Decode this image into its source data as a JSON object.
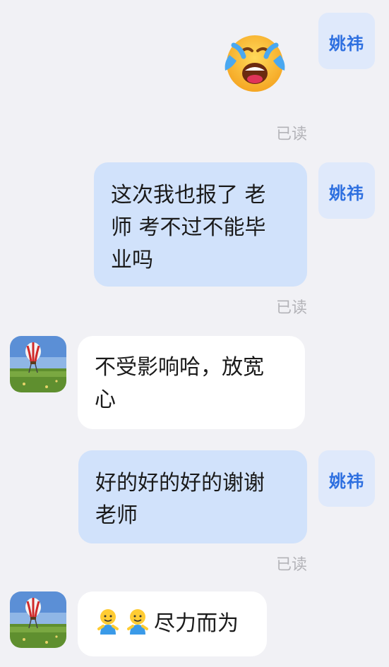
{
  "messages": [
    {
      "type": "outgoing-sticker",
      "sender": "姚祎",
      "sticker": "loudly-crying-face-icon",
      "status": "已读"
    },
    {
      "type": "outgoing-text",
      "sender": "姚祎",
      "lines": [
        "这次我也报了 老",
        "师 考不过不能毕",
        "业吗"
      ],
      "status": "已读"
    },
    {
      "type": "incoming-text",
      "avatar": "hot-air-balloon-photo",
      "lines": [
        "不受影响哈，放宽",
        "心"
      ]
    },
    {
      "type": "outgoing-text",
      "sender": "姚祎",
      "lines": [
        "好的好的好的谢谢",
        "老师"
      ],
      "status": "已读"
    },
    {
      "type": "incoming-text",
      "avatar": "hot-air-balloon-photo",
      "emojis": [
        "smiling-person-emoji",
        "smiling-person-emoji"
      ],
      "text": "尽力而为"
    }
  ],
  "colors": {
    "background": "#f1f1f5",
    "outgoing_bubble": "#d1e2fb",
    "incoming_bubble": "#ffffff",
    "name_avatar_bg": "#dfe9fb",
    "name_avatar_text": "#2d6fe0",
    "read_status": "#b3b3b8"
  }
}
